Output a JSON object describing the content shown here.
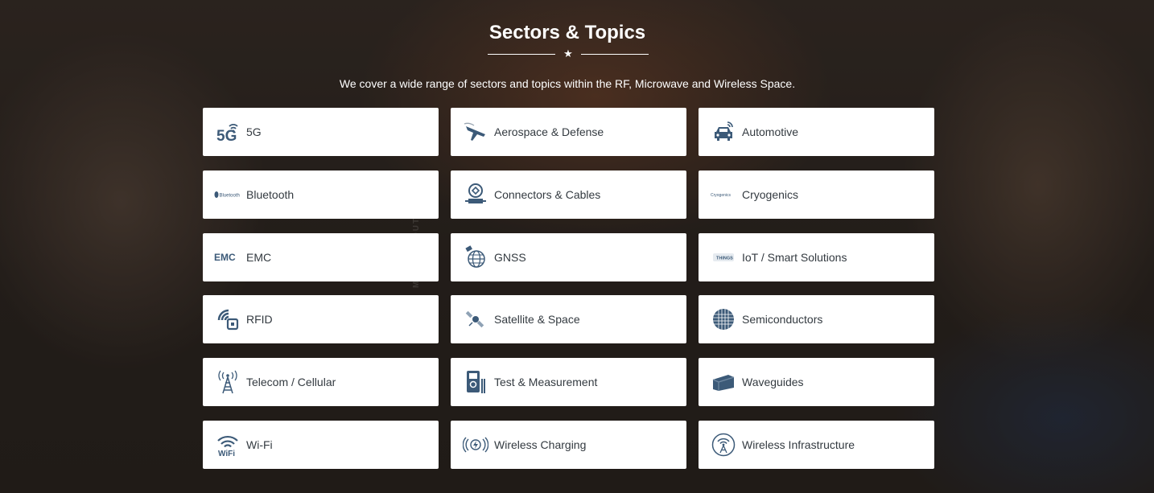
{
  "section": {
    "title": "Sectors & Topics",
    "subtitle": "We cover a wide range of sectors and topics within the RF, Microwave and Wireless Space.",
    "star": "★",
    "background_text": "MISSION OUTLINE"
  },
  "theme": {
    "icon_color": "#3c5a78",
    "card_bg": "#ffffff",
    "text_color": "#333a40"
  },
  "cards": [
    {
      "label": "5G",
      "icon": "5g-icon",
      "icon_text": "5G"
    },
    {
      "label": "Aerospace & Defense",
      "icon": "aircraft-icon"
    },
    {
      "label": "Automotive",
      "icon": "car-icon"
    },
    {
      "label": "Bluetooth",
      "icon": "bluetooth-logo-icon",
      "icon_text": "Bluetooth"
    },
    {
      "label": "Connectors & Cables",
      "icon": "connector-icon"
    },
    {
      "label": "Cryogenics",
      "icon": "cryogenics-logo-icon",
      "icon_text": "Cryogenics"
    },
    {
      "label": "EMC",
      "icon": "emc-logo-icon",
      "icon_text": "EMC"
    },
    {
      "label": "GNSS",
      "icon": "globe-satellite-icon"
    },
    {
      "label": "IoT / Smart Solutions",
      "icon": "things-logo-icon",
      "icon_text": "THINGS"
    },
    {
      "label": "RFID",
      "icon": "rfid-icon"
    },
    {
      "label": "Satellite & Space",
      "icon": "satellite-icon"
    },
    {
      "label": "Semiconductors",
      "icon": "chip-wafer-icon"
    },
    {
      "label": "Telecom / Cellular",
      "icon": "cell-tower-icon"
    },
    {
      "label": "Test & Measurement",
      "icon": "multimeter-icon"
    },
    {
      "label": "Waveguides",
      "icon": "waveguide-icon"
    },
    {
      "label": "Wi-Fi",
      "icon": "wifi-icon",
      "icon_text": "WiFi"
    },
    {
      "label": "Wireless Charging",
      "icon": "wireless-charging-icon"
    },
    {
      "label": "Wireless Infrastructure",
      "icon": "antenna-tower-icon"
    }
  ]
}
